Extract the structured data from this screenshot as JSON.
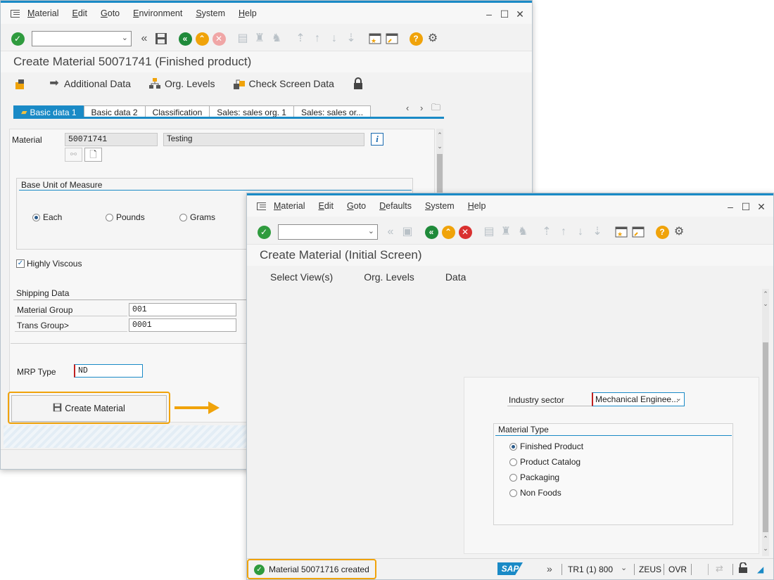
{
  "back_window": {
    "menu": [
      "Material",
      "Edit",
      "Goto",
      "Environment",
      "System",
      "Help"
    ],
    "title": "Create Material 50071741 (Finished product)",
    "app_toolbar": {
      "additional_data": "Additional Data",
      "org_levels": "Org. Levels",
      "check_screen_data": "Check Screen Data"
    },
    "tabs": [
      "Basic data 1",
      "Basic data 2",
      "Classification",
      "Sales: sales org. 1",
      "Sales: sales or..."
    ],
    "material_label": "Material",
    "material_number": "50071741",
    "material_description": "Testing",
    "info_glyph": "i",
    "base_uom": {
      "title": "Base Unit of Measure",
      "options": [
        "Each",
        "Pounds",
        "Grams"
      ],
      "selected": "Each"
    },
    "highly_viscous": "Highly Viscous",
    "shipping": {
      "title": "Shipping Data",
      "material_group_label": "Material Group",
      "material_group_value": "001",
      "trans_group_label": "Trans Group>",
      "trans_group_value": "0001"
    },
    "mrp_type_label": "MRP Type",
    "mrp_type_value": "ND",
    "create_button": "Create Material"
  },
  "front_window": {
    "menu": [
      "Material",
      "Edit",
      "Goto",
      "Defaults",
      "System",
      "Help"
    ],
    "title": "Create Material (Initial Screen)",
    "app_toolbar": [
      "Select View(s)",
      "Org. Levels",
      "Data"
    ],
    "industry_sector_label": "Industry sector",
    "industry_sector_value": "Mechanical Enginee...",
    "material_type": {
      "title": "Material Type",
      "options": [
        "Finished Product",
        "Product Catalog",
        "Packaging",
        "Non Foods"
      ],
      "selected": "Finished Product"
    },
    "status": {
      "message": "Material 50071716 created",
      "sap_logo": "SAP",
      "system": "TR1 (1) 800",
      "user": "ZEUS",
      "mode": "OVR"
    }
  },
  "colors": {
    "accent": "#1a8ac6",
    "highlight": "#f0a30a",
    "success": "#2f9b3e",
    "cancel": "#d9302f"
  },
  "icons": [
    "menu-icon",
    "enter-icon",
    "save-icon",
    "back-icon",
    "exit-icon",
    "cancel-icon",
    "print-icon",
    "find-icon",
    "settings-icon",
    "help-icon",
    "lock-icon",
    "arrow-right-icon"
  ]
}
